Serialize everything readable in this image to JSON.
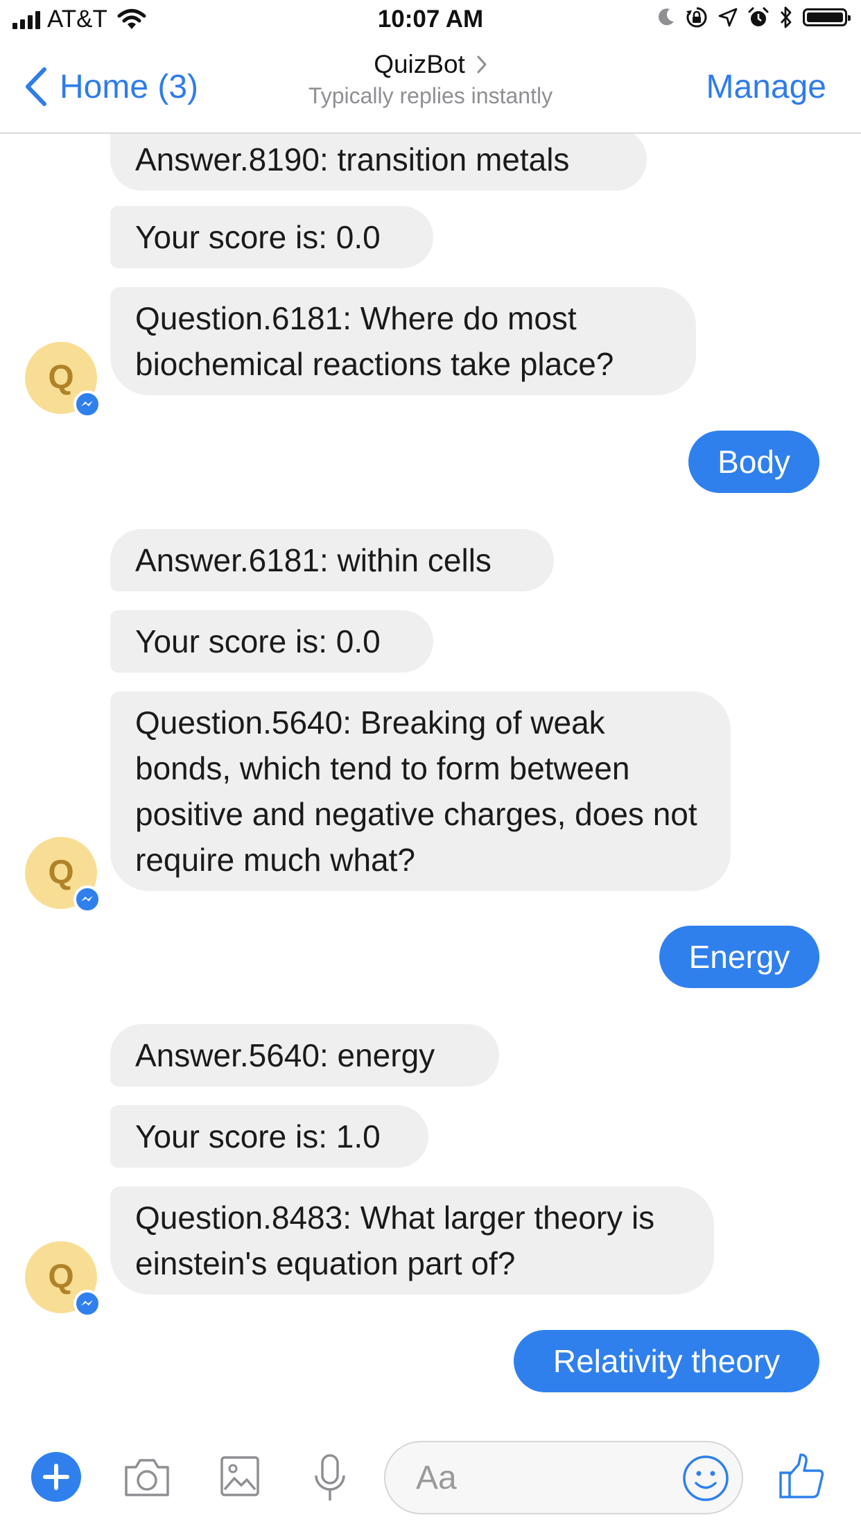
{
  "status_bar": {
    "carrier": "AT&T",
    "time": "10:07 AM",
    "icons": [
      "signal-icon",
      "wifi-icon",
      "moon-icon",
      "orientation-lock-icon",
      "location-icon",
      "alarm-icon",
      "bluetooth-icon",
      "battery-icon"
    ]
  },
  "nav": {
    "back_label": "Home (3)",
    "title": "QuizBot",
    "subtitle": "Typically replies instantly",
    "manage_label": "Manage"
  },
  "avatar": {
    "letter": "Q",
    "color": "#f8de95"
  },
  "colors": {
    "accent": "#2f80ed",
    "incoming_bubble": "#efefef",
    "link": "#2f7ce8"
  },
  "messages": [
    {
      "sender": "bot",
      "text": "Answer.8190: transition metals"
    },
    {
      "sender": "bot",
      "text": "Your score is: 0.0"
    },
    {
      "sender": "bot",
      "text": "Question.6181: Where do most biochemical reactions take place?"
    },
    {
      "sender": "user",
      "text": "Body"
    },
    {
      "sender": "bot",
      "text": "Answer.6181: within cells"
    },
    {
      "sender": "bot",
      "text": "Your score is: 0.0"
    },
    {
      "sender": "bot",
      "text": "Question.5640: Breaking of weak bonds, which tend to form between positive and negative charges, does not require much what?"
    },
    {
      "sender": "user",
      "text": "Energy"
    },
    {
      "sender": "bot",
      "text": "Answer.5640: energy"
    },
    {
      "sender": "bot",
      "text": "Your score is: 1.0"
    },
    {
      "sender": "bot",
      "text": "Question.8483: What larger theory is einstein's equation part of?"
    },
    {
      "sender": "user",
      "text": "Relativity theory"
    }
  ],
  "composer": {
    "placeholder": "Aa",
    "icons": [
      "plus-icon",
      "camera-icon",
      "image-icon",
      "microphone-icon",
      "emoji-icon",
      "thumbs-up-icon"
    ]
  }
}
